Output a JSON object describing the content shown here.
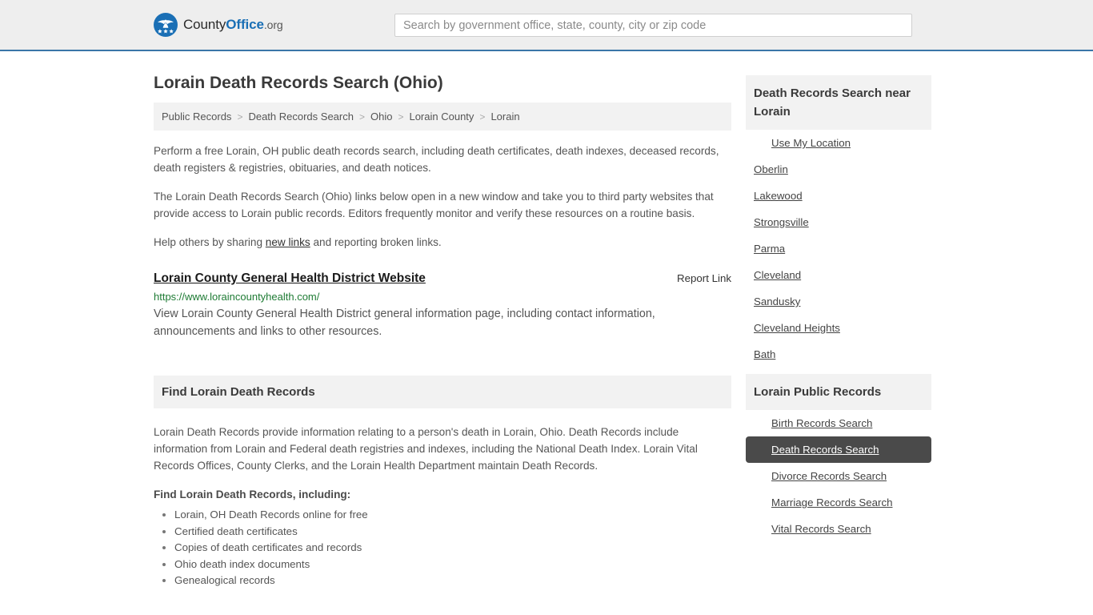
{
  "header": {
    "brand": {
      "part1": "County",
      "part2": "Office",
      "part3": ".org",
      "logo_icon": "eagle-seal-icon"
    },
    "search": {
      "placeholder": "Search by government office, state, county, city or zip code",
      "value": ""
    }
  },
  "page": {
    "title": "Lorain Death Records Search (Ohio)"
  },
  "breadcrumb": {
    "separator": ">",
    "items": [
      {
        "label": "Public Records"
      },
      {
        "label": "Death Records Search"
      },
      {
        "label": "Ohio"
      },
      {
        "label": "Lorain County"
      },
      {
        "label": "Lorain"
      }
    ]
  },
  "intro": {
    "p1": "Perform a free Lorain, OH public death records search, including death certificates, death indexes, deceased records, death registers & registries, obituaries, and death notices.",
    "p2": "The Lorain Death Records Search (Ohio) links below open in a new window and take you to third party websites that provide access to Lorain public records. Editors frequently monitor and verify these resources on a routine basis.",
    "p3_before": "Help others by sharing ",
    "p3_link": "new links",
    "p3_after": " and reporting broken links."
  },
  "result": {
    "title": "Lorain County General Health District Website",
    "report_label": "Report Link",
    "url": "https://www.loraincountyhealth.com/",
    "description": "View Lorain County General Health District general information page, including contact information, announcements and links to other resources."
  },
  "find_section": {
    "heading": "Find Lorain Death Records",
    "paragraph": "Lorain Death Records provide information relating to a person's death in Lorain, Ohio. Death Records include information from Lorain and Federal death registries and indexes, including the National Death Index. Lorain Vital Records Offices, County Clerks, and the Lorain Health Department maintain Death Records.",
    "sub_heading": "Find Lorain Death Records, including:",
    "bullets": [
      "Lorain, OH Death Records online for free",
      "Certified death certificates",
      "Copies of death certificates and records",
      "Ohio death index documents",
      "Genealogical records"
    ]
  },
  "sidebar": {
    "near": {
      "heading": "Death Records Search near Lorain",
      "items": [
        {
          "label": "Use My Location",
          "indented": true,
          "active": false
        },
        {
          "label": "Oberlin",
          "indented": false,
          "active": false
        },
        {
          "label": "Lakewood",
          "indented": false,
          "active": false
        },
        {
          "label": "Strongsville",
          "indented": false,
          "active": false
        },
        {
          "label": "Parma",
          "indented": false,
          "active": false
        },
        {
          "label": "Cleveland",
          "indented": false,
          "active": false
        },
        {
          "label": "Sandusky",
          "indented": false,
          "active": false
        },
        {
          "label": "Cleveland Heights",
          "indented": false,
          "active": false
        },
        {
          "label": "Bath",
          "indented": false,
          "active": false
        }
      ]
    },
    "public_records": {
      "heading": "Lorain Public Records",
      "items": [
        {
          "label": "Birth Records Search",
          "indented": true,
          "active": false
        },
        {
          "label": "Death Records Search",
          "indented": true,
          "active": true
        },
        {
          "label": "Divorce Records Search",
          "indented": true,
          "active": false
        },
        {
          "label": "Marriage Records Search",
          "indented": true,
          "active": false
        },
        {
          "label": "Vital Records Search",
          "indented": true,
          "active": false
        }
      ]
    }
  },
  "colors": {
    "header_bg": "#eeeeee",
    "header_border": "#3a76a8",
    "brand_blue": "#1a6fb5",
    "url_green": "#1e7b34",
    "panel_gray": "#f2f2f2",
    "active_bg": "#4a4a4a"
  }
}
